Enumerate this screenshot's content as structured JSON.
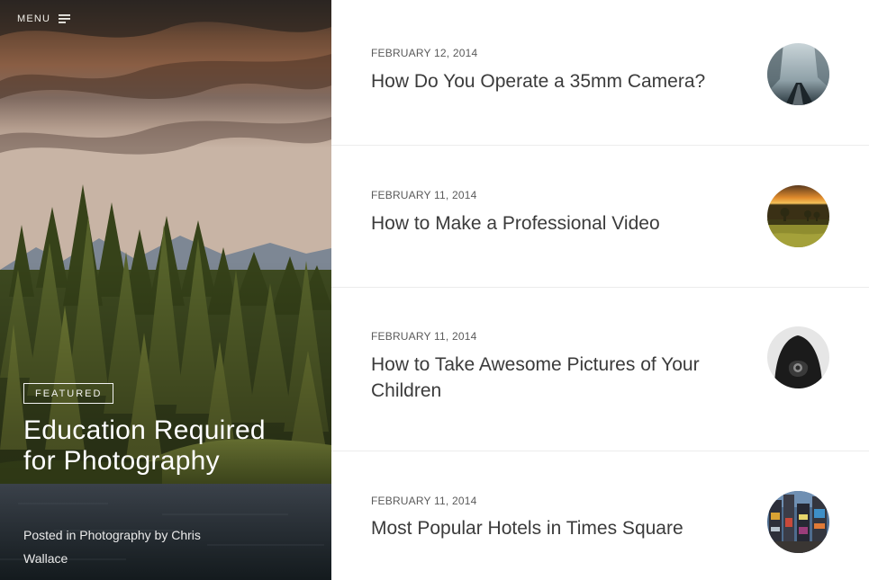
{
  "nav": {
    "menu_label": "MENU",
    "menu_icon": "hamburger-icon"
  },
  "featured": {
    "badge": "FEATURED",
    "title": "Education Required for Photography",
    "meta_prefix": "Posted in ",
    "category": "Photography",
    "meta_by": " by ",
    "author": "Chris Wallace",
    "image": "forest-lake-mountains-photo"
  },
  "posts": [
    {
      "date": "FEBRUARY 12, 2014",
      "title": "How Do You Operate a 35mm Camera?",
      "thumbnail": "misty-path-photo"
    },
    {
      "date": "FEBRUARY 11, 2014",
      "title": "How to Make a Professional Video",
      "thumbnail": "sunset-field-photo"
    },
    {
      "date": "FEBRUARY 11, 2014",
      "title": "How to Take Awesome Pictures of Your Children",
      "thumbnail": "hands-camera-photo"
    },
    {
      "date": "FEBRUARY 11, 2014",
      "title": "Most Popular Hotels in Times Square",
      "thumbnail": "times-square-photo"
    }
  ],
  "colors": {
    "post_title": "#3b3b3b",
    "post_date": "#5a5a5a",
    "divider": "#ececec",
    "background": "#ffffff"
  }
}
